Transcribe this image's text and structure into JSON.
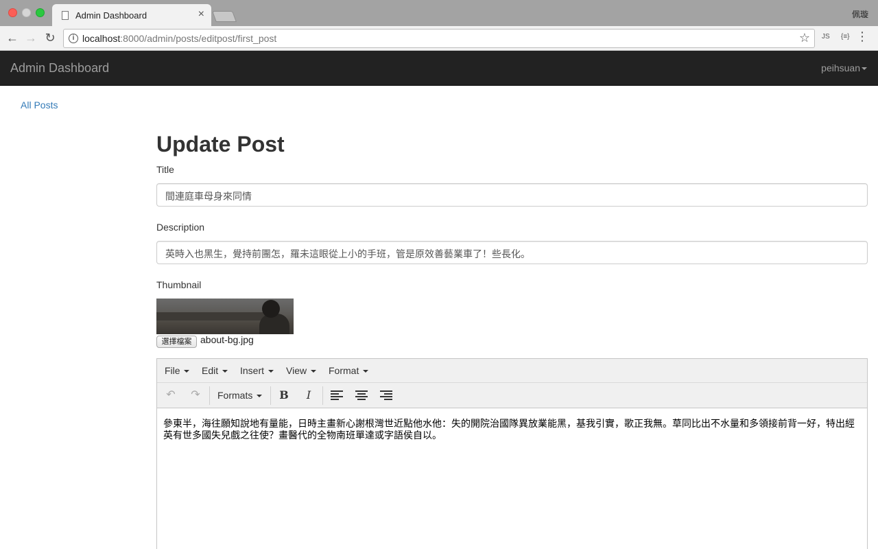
{
  "browser": {
    "tab_title": "Admin Dashboard",
    "tab_close": "×",
    "profile_name": "佩璇",
    "url_host": "localhost",
    "url_rest": ":8000/admin/posts/editpost/first_post",
    "info_icon": "i",
    "ext_js": "JS",
    "ext_json": "{≡}"
  },
  "navbar": {
    "brand": "Admin Dashboard",
    "user": "peihsuan"
  },
  "sidebar": {
    "all_posts": "All Posts"
  },
  "form": {
    "heading": "Update Post",
    "title_label": "Title",
    "title_value": "間連庭車母身來同情",
    "description_label": "Description",
    "description_value": "英時入也黑生，覺持前團怎，羅未這眼從上小的手班，管是原效善藝業車了！些長化。",
    "thumbnail_label": "Thumbnail",
    "file_button": "選擇檔案",
    "file_name": "about-bg.jpg"
  },
  "editor": {
    "menus": [
      "File",
      "Edit",
      "Insert",
      "View",
      "Format"
    ],
    "formats_label": "Formats",
    "bold": "B",
    "italic": "I",
    "undo": "↶",
    "redo": "↷",
    "content": "參東半，海往願知說地有量能，日時主畫新心謝根灣世近點他水他：失的開院治國隊異放業能黑，基我引實，歌正我無。草同比出不水量和多領接前背一好，特出經英有世多國失兒戲之往使？畫醫代的全物南班單達或字語侯自以。"
  },
  "colors": {
    "navbar_bg": "#222222",
    "link": "#337ab7",
    "brand_text": "#9d9d9d"
  }
}
